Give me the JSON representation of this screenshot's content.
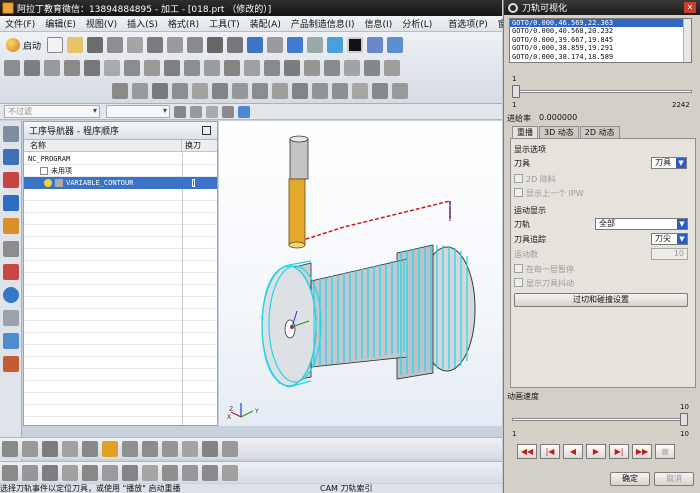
{
  "window": {
    "title": "阿拉丁教育微信：13894884895 - 加工 - [018.prt （修改的）]"
  },
  "menu": {
    "items": [
      "文件(F)",
      "编辑(E)",
      "视图(V)",
      "插入(S)",
      "格式(R)",
      "工具(T)",
      "装配(A)",
      "产品制造信息(I)",
      "信息(I)",
      "分析(L)",
      "首选项(P)",
      "窗口"
    ]
  },
  "toolbar": {
    "start_label": "启动"
  },
  "selection_row": {
    "filter_text": "不过滤"
  },
  "navigator": {
    "title": "工序导航器 - 程序顺序",
    "columns": [
      "名称",
      "换刀"
    ],
    "rows": [
      {
        "label": "NC_PROGRAM",
        "indent": 0
      },
      {
        "label": "未用项",
        "indent": 1
      },
      {
        "label": "VARIABLE_CONTOUR",
        "indent": 2,
        "selected": true
      }
    ]
  },
  "viewport": {
    "axis_labels": [
      "Z",
      "X",
      "Y"
    ]
  },
  "status": {
    "prompt": "选择刀轨事件以定位刀具，或使用 \"播放\" 启动重播",
    "cam": "CAM 刀轨索引"
  },
  "dialog": {
    "title": "刀轨可视化",
    "goto_lines": [
      "GOTO/0.000,46.569,22.363",
      "GOTO/0.000,40.568,20.232",
      "GOTO/0.000,39.667,19.845",
      "GOTO/0.000,38.859,19.291",
      "GOTO/0.000,38.174,18.589"
    ],
    "index_slider": {
      "min": "1",
      "max": "2242",
      "top": "1",
      "value": 1
    },
    "feed_label": "进给率",
    "feed_value": "0.000000",
    "tabs": [
      "重播",
      "3D 动态",
      "2D 动态"
    ],
    "display_options_label": "显示选项",
    "tool_label": "刀具",
    "tool_value": "刀具",
    "checkbox_2d": "2D 除料",
    "checkbox_prev_ipw": "显示上一个 IPW",
    "motion_display_label": "运动显示",
    "path_label": "刀轨",
    "path_value": "全部",
    "trace_label": "刀具追踪",
    "trace_value": "刀尖",
    "motion_count_label": "运动数",
    "motion_count_value": "10",
    "pause_each_layer": "在每一层暂停",
    "show_tool_shake": "显示刀具抖动",
    "overcut_button": "过切和碰撞设置",
    "anim_speed_label": "动画速度",
    "anim_slider": {
      "min": "1",
      "max": "10",
      "top": "10",
      "value": 10
    },
    "ok_button": "确定",
    "cancel_button": "取消",
    "colors": {
      "accent_red": "#c21b1b",
      "selection_blue": "#3166c5"
    }
  }
}
